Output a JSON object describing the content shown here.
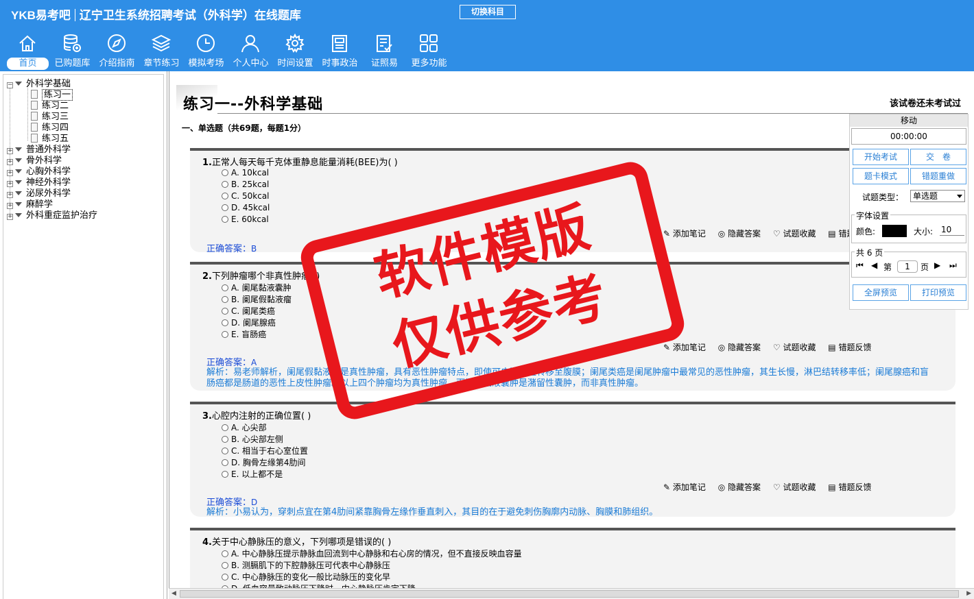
{
  "app": {
    "brand": "YKB易考吧",
    "title": "辽宁卫生系统招聘考试（外科学）在线题库",
    "switch_label": "切换科目"
  },
  "nav": [
    {
      "label": "首页",
      "icon": "home-icon"
    },
    {
      "label": "已购题库",
      "icon": "database-icon"
    },
    {
      "label": "介绍指南",
      "icon": "compass-icon"
    },
    {
      "label": "章节练习",
      "icon": "layers-icon"
    },
    {
      "label": "模拟考场",
      "icon": "clock-icon"
    },
    {
      "label": "个人中心",
      "icon": "user-icon"
    },
    {
      "label": "时间设置",
      "icon": "gear-icon"
    },
    {
      "label": "时事政治",
      "icon": "newspaper-icon"
    },
    {
      "label": "证照易",
      "icon": "checklist-icon"
    },
    {
      "label": "更多功能",
      "icon": "grid-icon"
    }
  ],
  "tree": {
    "root": "外科学基础",
    "children": [
      "练习一",
      "练习二",
      "练习三",
      "练习四",
      "练习五"
    ],
    "groups": [
      "普通外科学",
      "骨外科学",
      "心胸外科学",
      "神经外科学",
      "泌尿外科学",
      "麻醉学",
      "外科重症监护治疗"
    ]
  },
  "main": {
    "title": "练习一--外科学基础",
    "status": "该试卷还未考试过",
    "section": "一、单选题（共69题，每题1分）"
  },
  "tools": {
    "note": "添加笔记",
    "hide": "隐藏答案",
    "fav": "试题收藏",
    "feedback": "错题反馈"
  },
  "questions": [
    {
      "num": "1.",
      "text": "正常人每天每千克体重静息能量消耗(BEE)为( )",
      "options": [
        "A. 10kcal",
        "B. 25kcal",
        "C. 50kcal",
        "D. 45kcal",
        "E. 60kcal"
      ],
      "answer_label": "正确答案：",
      "answer": "B",
      "analysis": ""
    },
    {
      "num": "2.",
      "text": "下列肿瘤哪个非真性肿瘤( )",
      "options": [
        "A. 阑尾黏液囊肿",
        "B. 阑尾假黏液瘤",
        "C. 阑尾类癌",
        "D. 阑尾腺癌",
        "E. 盲肠癌"
      ],
      "answer_label": "正确答案：",
      "answer": "A",
      "analysis": "解析：易老师解析，阑尾假黏液瘤是真性肿瘤，具有恶性肿瘤特点，即使可广泛种植转移至腹膜；阑尾类癌是阑尾肿瘤中最常见的恶性肿瘤，其生长慢，淋巴结转移率低；阑尾腺癌和盲肠癌都是肠道的恶性上皮性肿瘤。以上四个肿瘤均为真性肿瘤。而阑尾黏液囊肿是潴留性囊肿，而非真性肿瘤。"
    },
    {
      "num": "3.",
      "text": "心腔内注射的正确位置( )",
      "options": [
        "A. 心尖部",
        "B. 心尖部左侧",
        "C. 相当于右心室位置",
        "D. 胸骨左缘第4肋间",
        "E. 以上都不是"
      ],
      "answer_label": "正确答案：",
      "answer": "D",
      "analysis": "解析：小易认为，穿刺点宜在第4肋间紧靠胸骨左缘作垂直刺入，其目的在于避免刺伤胸廓内动脉、胸膜和肺组织。"
    },
    {
      "num": "4.",
      "text": "关于中心静脉压的意义，下列哪项是错误的( )",
      "options": [
        "A. 中心静脉压提示静脉血回流到中心静脉和右心房的情况，但不直接反映血容量",
        "B. 测膈肌下的下腔静脉压可代表中心静脉压",
        "C. 中心静脉压的变化一般比动脉压的变化早",
        "D. 低血容量致动脉压下降时，中心静脉压肯定下降"
      ],
      "answer_label": "",
      "answer": "",
      "analysis": ""
    }
  ],
  "panel": {
    "move": "移动",
    "timer": "00:00:00",
    "start": "开始考试",
    "submit": "交　卷",
    "card_mode": "题卡模式",
    "redo": "错题重做",
    "type_label": "试题类型：",
    "type_value": "单选题",
    "font_legend": "字体设置",
    "color_label": "颜色:",
    "size_label": "大小:",
    "size_value": "10",
    "font_color": "#000000",
    "pages_legend": "共 6 页",
    "page_prefix": "第",
    "page_value": "1",
    "page_suffix": "页",
    "fullscreen": "全屏预览",
    "print": "打印预览"
  },
  "watermark": {
    "line1": "软件模版",
    "line2": "仅供参考"
  },
  "colors": {
    "header": "#2f8ee6",
    "answer": "#1a4bd6",
    "stamp": "#e8171c"
  }
}
